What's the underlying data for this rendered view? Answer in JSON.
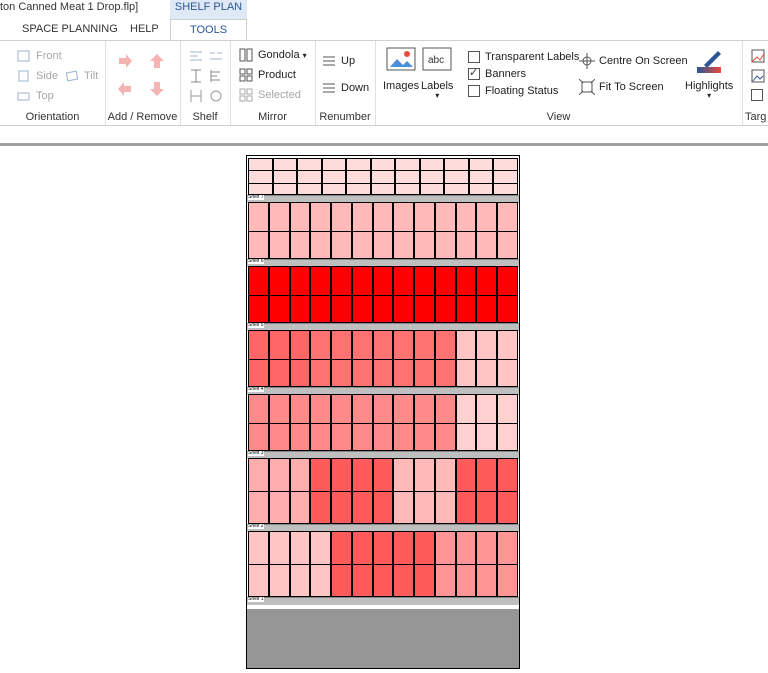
{
  "window": {
    "title": "ton Canned Meat 1 Drop.flp]",
    "context_tab": "SHELF PLAN"
  },
  "tabs": [
    {
      "label": "SPACE PLANNING",
      "active": false
    },
    {
      "label": "HELP",
      "active": false
    },
    {
      "label": "TOOLS",
      "active": true
    }
  ],
  "ribbon": {
    "orientation": {
      "label": "Orientation",
      "front": "Front",
      "side": "Side",
      "top": "Top",
      "tilt": "Tilt"
    },
    "add_remove": {
      "label": "Add / Remove"
    },
    "shelf": {
      "label": "Shelf"
    },
    "mirror": {
      "label": "Mirror",
      "gondola": "Gondola",
      "product": "Product",
      "selected": "Selected"
    },
    "renumber": {
      "label": "Renumber",
      "up": "Up",
      "down": "Down"
    },
    "view": {
      "label": "View",
      "images": "Images",
      "labels": "Labels",
      "transparent_labels": "Transparent Labels",
      "banners": "Banners",
      "floating_status": "Floating Status",
      "centre_on_screen": "Centre On Screen",
      "fit_to_screen": "Fit To Screen",
      "highlights": "Highlights",
      "checks": {
        "transparent_labels": false,
        "banners": true,
        "floating_status": false
      }
    },
    "target": {
      "label": "Targ"
    }
  },
  "colors": {
    "accent": "#2b5797",
    "shelf": "#bfbfbf",
    "base": "#969696",
    "hl_max": "#ff0000"
  },
  "planogram": {
    "shelves": [
      {
        "label": "Shelf 7",
        "rows": 3,
        "cols": 11,
        "cells": [
          0.15,
          0.15,
          0.15,
          0.15,
          0.15,
          0.15,
          0.15,
          0.15,
          0.15,
          0.15,
          0.15
        ]
      },
      {
        "label": "Shelf 6",
        "rows": 2,
        "cols": 13,
        "cells": [
          0.3,
          0.3,
          0.3,
          0.3,
          0.3,
          0.3,
          0.3,
          0.3,
          0.3,
          0.3,
          0.3,
          0.3,
          0.3
        ]
      },
      {
        "label": "Shelf 5",
        "rows": 2,
        "cols": 13,
        "cells": [
          1,
          1,
          1,
          1,
          1,
          1,
          1,
          1,
          1,
          1,
          1,
          1,
          1
        ]
      },
      {
        "label": "Shelf 4",
        "rows": 2,
        "cols": 13,
        "cells": [
          0.65,
          0.65,
          0.65,
          0.6,
          0.6,
          0.6,
          0.6,
          0.6,
          0.6,
          0.6,
          0.25,
          0.25,
          0.25
        ]
      },
      {
        "label": "Shelf 3",
        "rows": 2,
        "cols": 13,
        "cells": [
          0.5,
          0.5,
          0.5,
          0.5,
          0.5,
          0.5,
          0.5,
          0.5,
          0.5,
          0.5,
          0.2,
          0.2,
          0.2
        ]
      },
      {
        "label": "Shelf 2",
        "rows": 2,
        "cols": 13,
        "cells": [
          0.35,
          0.35,
          0.35,
          0.7,
          0.7,
          0.7,
          0.7,
          0.3,
          0.3,
          0.3,
          0.7,
          0.7,
          0.7
        ]
      },
      {
        "label": "Shelf 1",
        "rows": 2,
        "cols": 13,
        "cells": [
          0.25,
          0.25,
          0.25,
          0.25,
          0.7,
          0.7,
          0.7,
          0.7,
          0.7,
          0.45,
          0.45,
          0.45,
          0.45
        ]
      }
    ]
  }
}
